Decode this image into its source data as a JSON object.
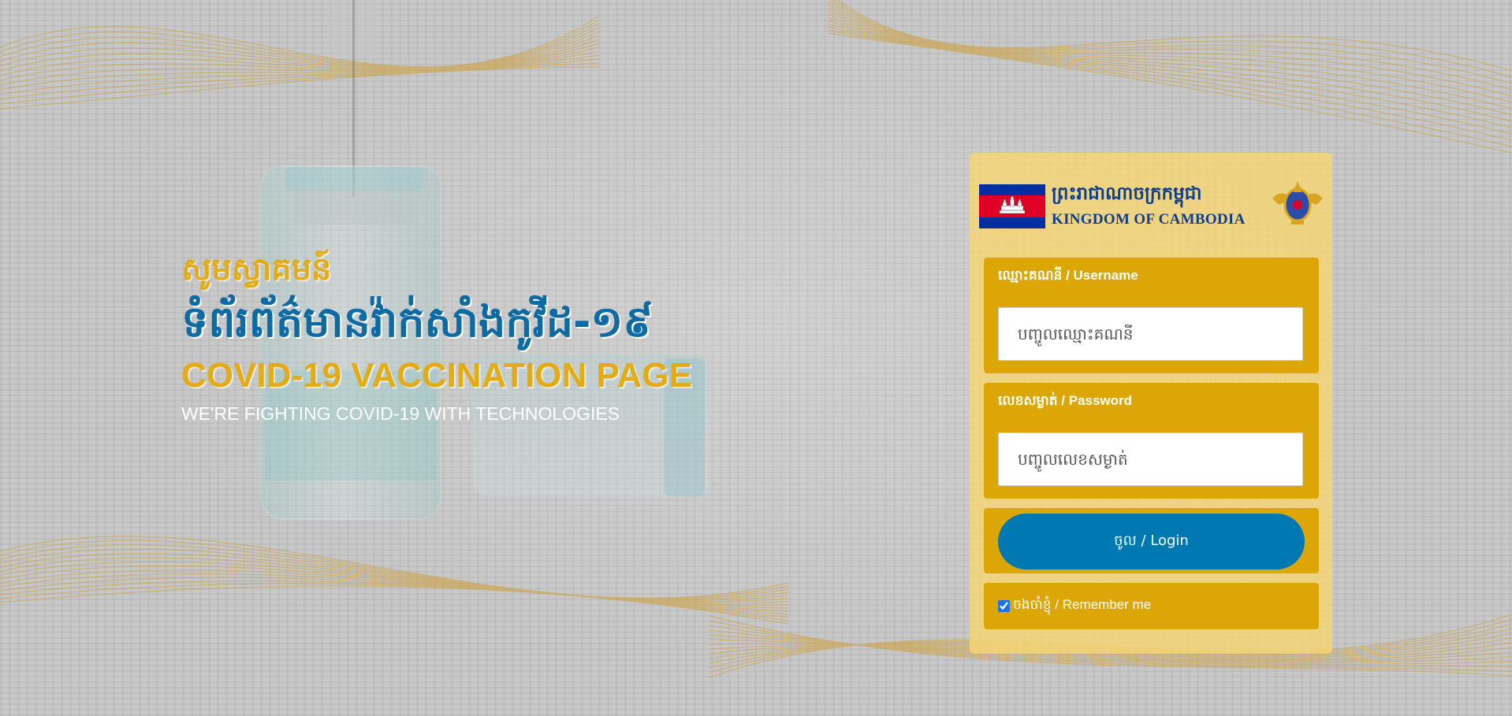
{
  "hero": {
    "welcome": "សូមស្វាគមន៍",
    "title_kh": "ទំព័រព័ត៌មានវ៉ាក់សាំងកូវីដ-១៩",
    "title_en": "COVID-19 VACCINATION PAGE",
    "tagline": "WE'RE FIGHTING COVID-19 WITH TECHNOLOGIES"
  },
  "brand": {
    "name_kh": "ព្រះរាជាណាចក្រកម្ពុជា",
    "name_en": "KINGDOM OF CAMBODIA",
    "flag_icon": "cambodia-flag-icon",
    "emblem_icon": "royal-emblem-icon"
  },
  "form": {
    "username_label": "ឈ្មោះគណនី / Username",
    "username_placeholder": "បញ្ចូលឈ្មោះគណនី",
    "username_value": "",
    "password_label": "លេខសម្ងាត់ / Password",
    "password_placeholder": "បញ្ចូលលេខសម្ងាត់",
    "password_value": "",
    "login_label": "ចូល / Login",
    "remember_label": "ចងចាំខ្ញុំ / Remember me",
    "remember_checked": true
  },
  "colors": {
    "accent_gold": "#dca706",
    "primary_blue": "#0079b3",
    "title_blue": "#0e6aa3",
    "card_bg": "#f8d672"
  }
}
